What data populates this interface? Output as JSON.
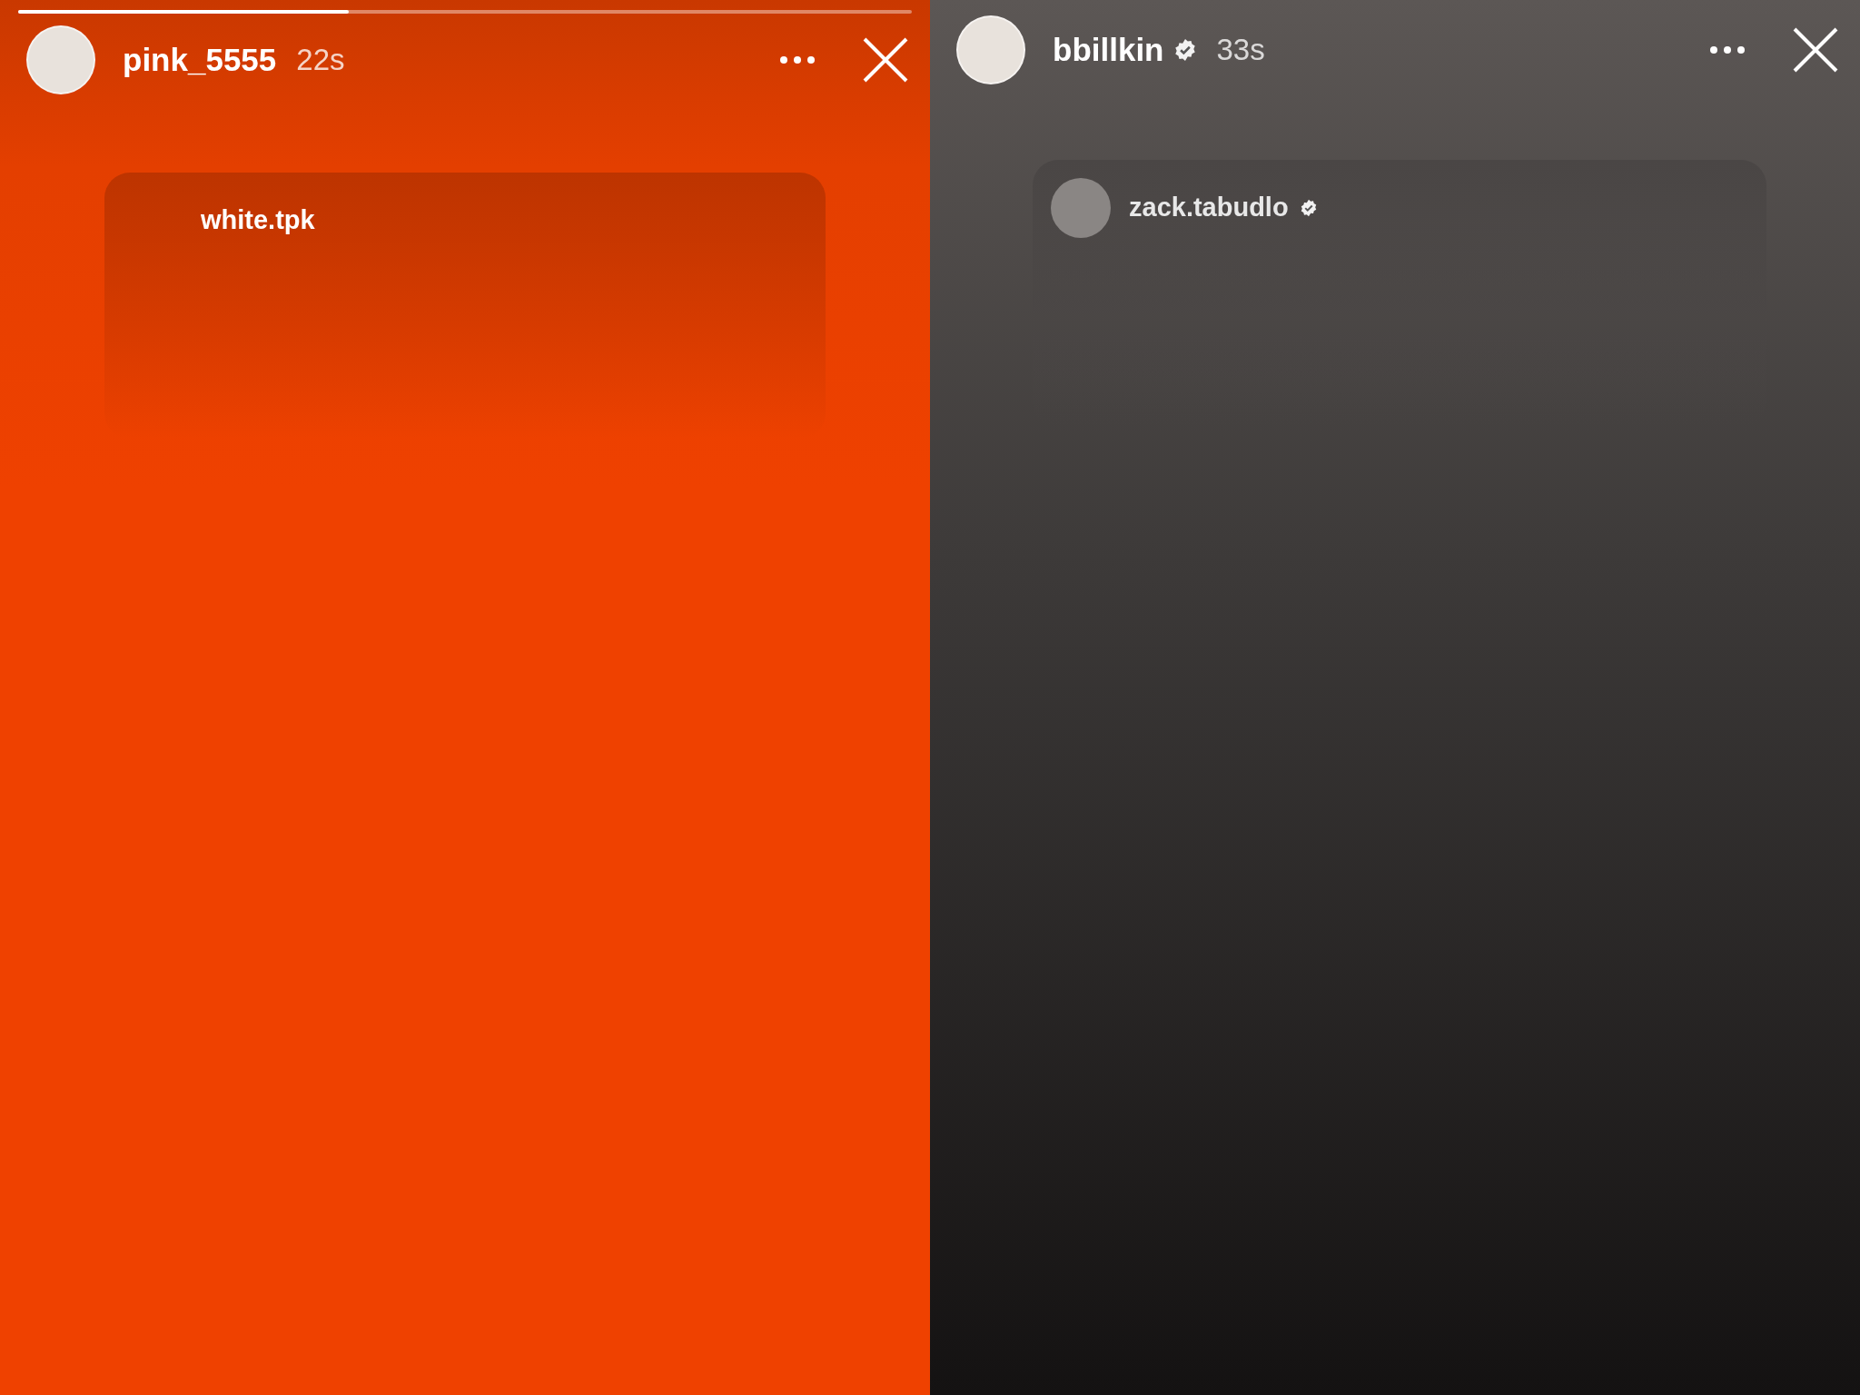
{
  "stories": [
    {
      "kind": "orange",
      "progress": {
        "level": 0.37
      },
      "header": {
        "username": "pink_5555",
        "verified": false,
        "time": "22s"
      },
      "card": {
        "username": "white.tpk",
        "verified": false,
        "avatar": false
      }
    },
    {
      "kind": "dark",
      "header": {
        "username": "bbillkin",
        "verified": true,
        "time": "33s"
      },
      "card": {
        "username": "zack.tabudlo",
        "verified": true,
        "avatar": true
      }
    }
  ]
}
